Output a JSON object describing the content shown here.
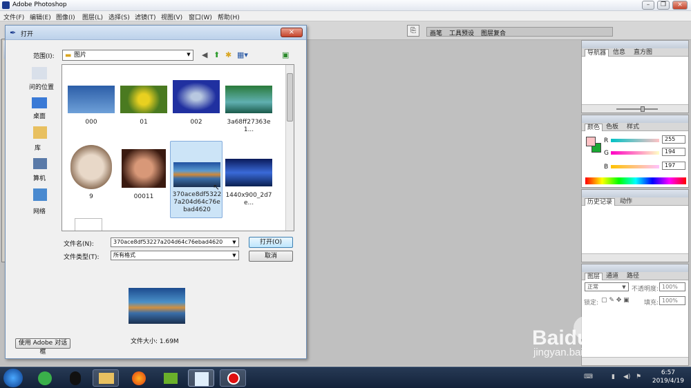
{
  "window": {
    "title": "Adobe Photoshop"
  },
  "menu": [
    "文件(F)",
    "编辑(E)",
    "图像(I)",
    "图层(L)",
    "选择(S)",
    "滤镜(T)",
    "视图(V)",
    "窗口(W)",
    "帮助(H)"
  ],
  "palette_well": [
    "画笔",
    "工具预设",
    "图层复合"
  ],
  "navigator": {
    "tabs": [
      "导航器",
      "信息",
      "直方图"
    ]
  },
  "color_panel": {
    "tabs": [
      "颜色",
      "色板",
      "样式"
    ],
    "r_label": "R",
    "g_label": "G",
    "b_label": "B",
    "r": "255",
    "g": "194",
    "b": "197",
    "fg_color": "#ffc2c5",
    "bg_color": "#1aa832"
  },
  "history_panel": {
    "tabs": [
      "历史记录",
      "动作"
    ]
  },
  "layers_panel": {
    "tabs": [
      "图层",
      "通道",
      "路径"
    ],
    "blend_mode": "正常",
    "opacity_label": "不透明度:",
    "opacity": "100%",
    "lock_label": "锁定:",
    "fill_label": "填充:",
    "fill": "100%"
  },
  "dialog": {
    "title": "打开",
    "lookin_label": "范围(I):",
    "lookin_value": "图片",
    "places": [
      "问的位置",
      "桌面",
      "库",
      "算机",
      "网络"
    ],
    "files": [
      {
        "name": "000",
        "icon": "image-thumb-woman"
      },
      {
        "name": "01",
        "icon": "image-thumb-flowers"
      },
      {
        "name": "002",
        "icon": "image-thumb-fish"
      },
      {
        "name": "3a68ff27363e1...",
        "icon": "image-thumb-lake"
      },
      {
        "name": "9",
        "icon": "image-thumb-mickey"
      },
      {
        "name": "00011",
        "icon": "image-thumb-girl"
      },
      {
        "name": "370ace8df53227a204d64c76ebad4620",
        "icon": "image-thumb-mountain-reflection"
      },
      {
        "name": "1440x900_2d7e...",
        "icon": "image-thumb-blue-landscape"
      }
    ],
    "filename_label": "文件名(N):",
    "filename_value": "370ace8df53227a204d64c76ebad4620",
    "filetype_label": "文件类型(T):",
    "filetype_value": "所有格式",
    "open_button": "打开(O)",
    "cancel_button": "取消",
    "filesize": "文件大小: 1.69M",
    "adobe_dialog_button": "使用 Adobe 对话框"
  },
  "taskbar": {
    "time": "6:57",
    "date": "2019/4/19"
  },
  "watermark": {
    "brand": "Baidu经验",
    "url": "jingyan.baidu.com"
  }
}
